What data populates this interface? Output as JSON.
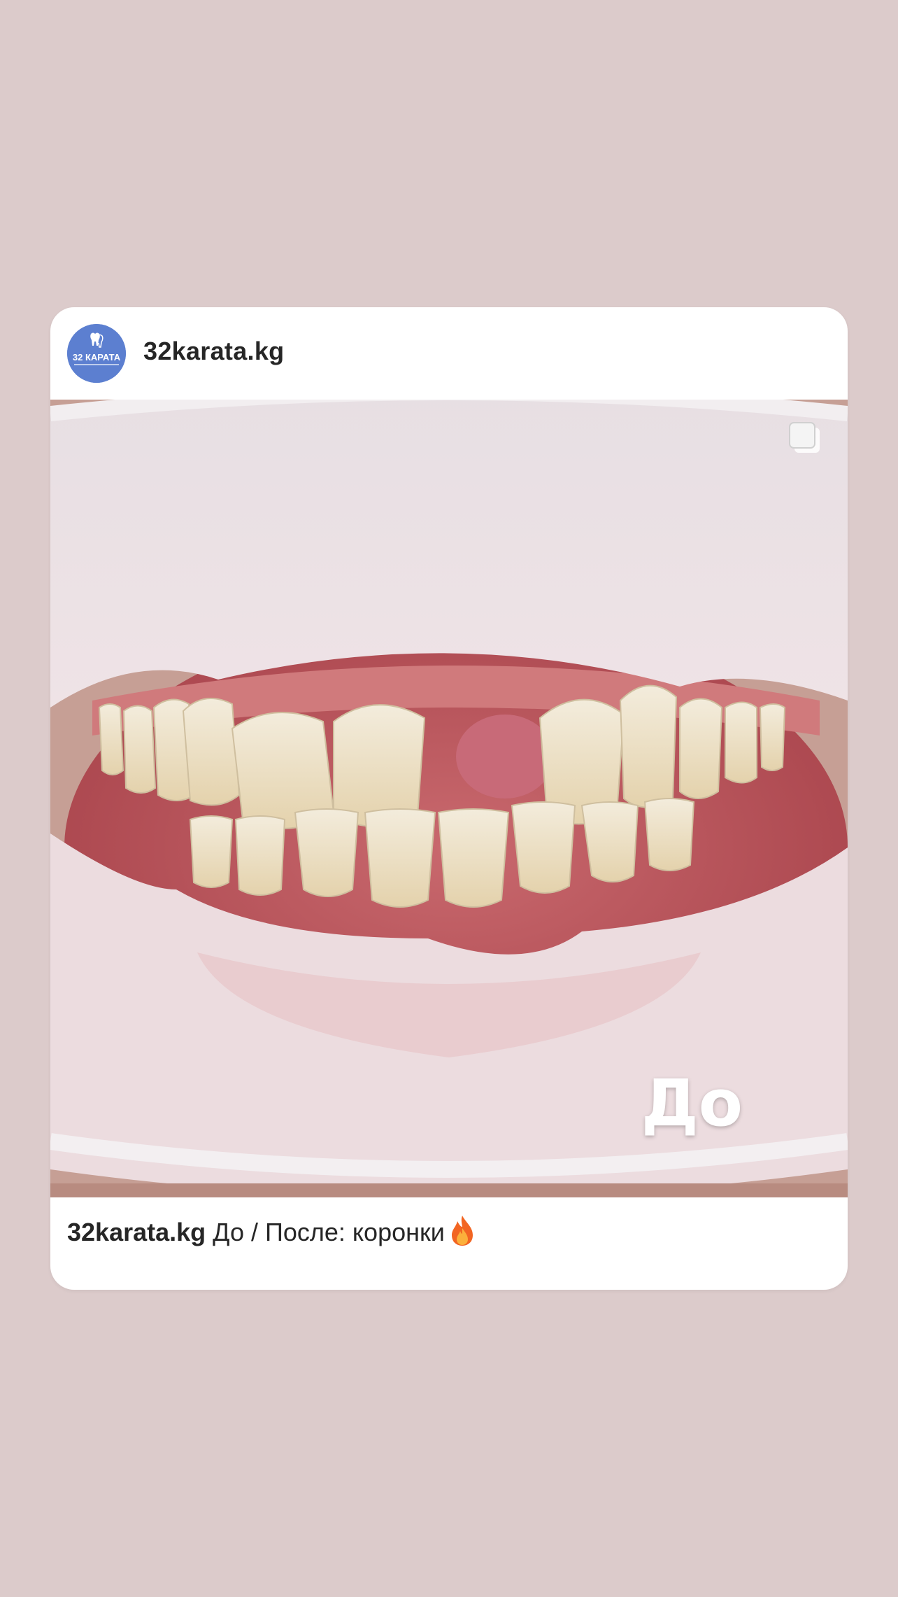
{
  "post": {
    "username": "32karata.kg",
    "avatar_text": "32 КАРАТА",
    "image_overlay_label": "До",
    "caption_user": "32karata.kg",
    "caption_text": "До / После: коронки",
    "caption_emoji": "flame-icon",
    "multi_image_icon": "carousel-icon"
  },
  "colors": {
    "background": "#dccbcb",
    "card": "#ffffff",
    "avatar": "#5c7fd0",
    "text": "#262626"
  }
}
